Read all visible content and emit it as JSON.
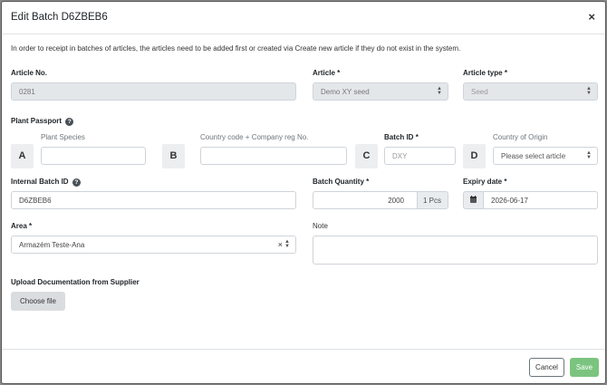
{
  "modal": {
    "title": "Edit Batch D6ZBEB6",
    "close_glyph": "×",
    "info": "In order to receipt in batches of articles, the articles need to be added first or created via Create new article if they do not exist in the system."
  },
  "article_no": {
    "label": "Article No.",
    "value": "0281"
  },
  "article": {
    "label": "Article",
    "required": "*",
    "value": "Demo XY seed"
  },
  "article_type": {
    "label": "Article type",
    "required": "*",
    "value": "Seed"
  },
  "plant_passport": {
    "label": "Plant Passport",
    "help_glyph": "?",
    "a": {
      "letter": "A",
      "label": "Plant Species",
      "value": ""
    },
    "b": {
      "letter": "B",
      "label": "Country code + Company reg No.",
      "value": ""
    },
    "c": {
      "letter": "C",
      "label": "Batch ID",
      "required": "*",
      "placeholder": "DXY"
    },
    "d": {
      "letter": "D",
      "label": "Country of Origin",
      "placeholder": "Please select article"
    }
  },
  "internal_batch": {
    "label": "Internal Batch ID",
    "help_glyph": "?",
    "value": "D6ZBEB6"
  },
  "batch_quantity": {
    "label": "Batch Quantity",
    "required": "*",
    "value": "2000",
    "unit": "1 Pcs"
  },
  "expiry_date": {
    "label": "Expiry date",
    "required": "*",
    "value": "2026-06-17",
    "icon": "calendar-icon"
  },
  "area": {
    "label": "Area",
    "required": "*",
    "value": "Armazém Teste-Ana",
    "clear_glyph": "×"
  },
  "note": {
    "label": "Note",
    "value": ""
  },
  "upload": {
    "label": "Upload Documentation from Supplier",
    "button": "Choose file"
  },
  "footer": {
    "cancel": "Cancel",
    "save": "Save"
  },
  "colors": {
    "save_bg": "#7bc47f",
    "disabled_bg": "#e4e7ea",
    "backdrop": "#8a8a8a"
  }
}
